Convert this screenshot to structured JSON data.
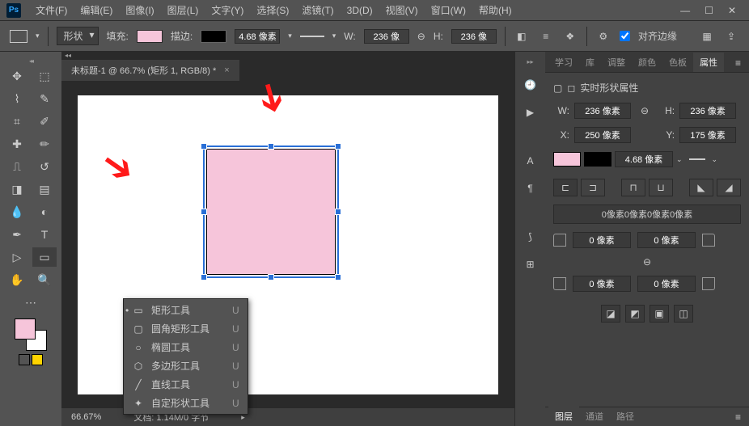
{
  "menubar": {
    "items": [
      "文件(F)",
      "编辑(E)",
      "图像(I)",
      "图层(L)",
      "文字(Y)",
      "选择(S)",
      "滤镜(T)",
      "3D(D)",
      "视图(V)",
      "窗口(W)",
      "帮助(H)"
    ]
  },
  "optionbar": {
    "mode_label": "形状",
    "fill_label": "填充:",
    "stroke_label": "描边:",
    "stroke_width": "4.68 像素",
    "w_label": "W:",
    "w_value": "236 像",
    "h_label": "H:",
    "h_value": "236 像",
    "align_label": "对齐边缘",
    "fill_color": "#f6c5da",
    "stroke_color": "#000000"
  },
  "document": {
    "tab_title": "未标题-1 @ 66.7% (矩形 1, RGB/8) *",
    "zoom": "66.67%",
    "status": "文档: 1.14M/0 字节"
  },
  "shape_flyout": {
    "items": [
      {
        "icon": "▭",
        "label": "矩形工具",
        "key": "U",
        "selected": true
      },
      {
        "icon": "▢",
        "label": "圆角矩形工具",
        "key": "U"
      },
      {
        "icon": "○",
        "label": "椭圆工具",
        "key": "U"
      },
      {
        "icon": "⬡",
        "label": "多边形工具",
        "key": "U"
      },
      {
        "icon": "╱",
        "label": "直线工具",
        "key": "U"
      },
      {
        "icon": "✦",
        "label": "自定形状工具",
        "key": "U"
      }
    ]
  },
  "panels": {
    "top_tabs": [
      "学习",
      "库",
      "调整",
      "颜色",
      "色板",
      "属性"
    ],
    "active_tab": "属性",
    "prop_title": "实时形状属性",
    "w_label": "W:",
    "w_value": "236 像素",
    "h_label": "H:",
    "h_value": "236 像素",
    "x_label": "X:",
    "x_value": "250 像素",
    "y_label": "Y:",
    "y_value": "175 像素",
    "stroke_width": "4.68 像素",
    "corners_summary": "0像素0像素0像素0像素",
    "corner_value": "0 像素",
    "link_icon": "⊖",
    "footer_tabs": [
      "图层",
      "通道",
      "路径"
    ],
    "fill_color": "#f6c5da",
    "stroke_color": "#000000"
  }
}
